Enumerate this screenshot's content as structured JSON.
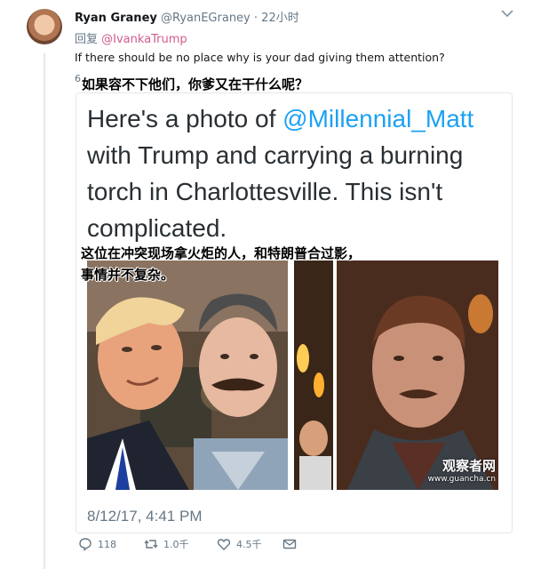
{
  "tweet": {
    "author_name": "Ryan Graney",
    "author_handle": "@RyanEGraney",
    "separator": "·",
    "time": "22小时",
    "reply_prefix": "回复",
    "reply_to": "@IvankaTrump",
    "text": "If there should be no place why is your dad giving them attention?",
    "cn_caption": "如果容不下他们，你爹又在干什么呢？",
    "quote_mark": "6"
  },
  "quoted": {
    "text_prefix": "Here's a photo of ",
    "mention": "@Millennial_Matt",
    "text_rest": " with Trump and carrying a burning torch in Charlottesville. This isn't complicated.",
    "cn_caption_line1": "这位在冲突现场拿火炬的人，和特朗普合过影，",
    "cn_caption_line2": "事情并不复杂。",
    "date": "8/12/17, 4:41 PM",
    "watermark_main": "观察者网",
    "watermark_url": "www.guancha.cn"
  },
  "actions": {
    "replies": "118",
    "retweets": "1.0千",
    "likes": "4.5千"
  },
  "colors": {
    "link": "#1da1f2",
    "mention_reply": "#d05c8d",
    "muted": "#657786"
  }
}
